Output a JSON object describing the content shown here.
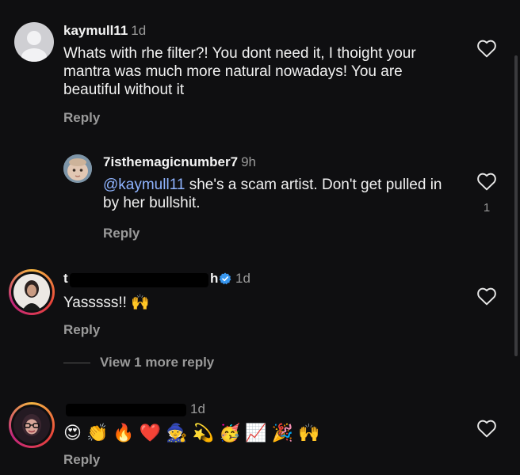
{
  "comments": [
    {
      "username": "kaymull11",
      "time": "1d",
      "text": "Whats with rhe filter?! You dont need it, I thoight your mantra was much more natural nowadays! You are beautiful without it",
      "reply_label": "Reply"
    },
    {
      "username": "7isthemagicnumber7",
      "time": "9h",
      "mention": "@kaymull11",
      "text": " she's a scam artist. Don't get pulled in by her bullshit.",
      "reply_label": "Reply",
      "like_count": "1"
    },
    {
      "username_visible_start": "t",
      "username_visible_end": "h",
      "time": "1d",
      "text": "Yasssss!! 🙌",
      "reply_label": "Reply",
      "view_more_label": "View 1 more reply"
    },
    {
      "username_visible_end": "1d",
      "emojis": [
        "😍",
        "👏",
        "🔥",
        "❤️",
        "🧙",
        "💫",
        "🥳",
        "📈",
        "🎉",
        "🙌"
      ],
      "reply_label": "Reply"
    }
  ],
  "icons": {
    "heart": "heart-outline-icon",
    "verified": "verified-badge-icon"
  },
  "colors": {
    "background": "#0f0f11",
    "mention": "#8fb4ff",
    "verified": "#3897f0"
  }
}
